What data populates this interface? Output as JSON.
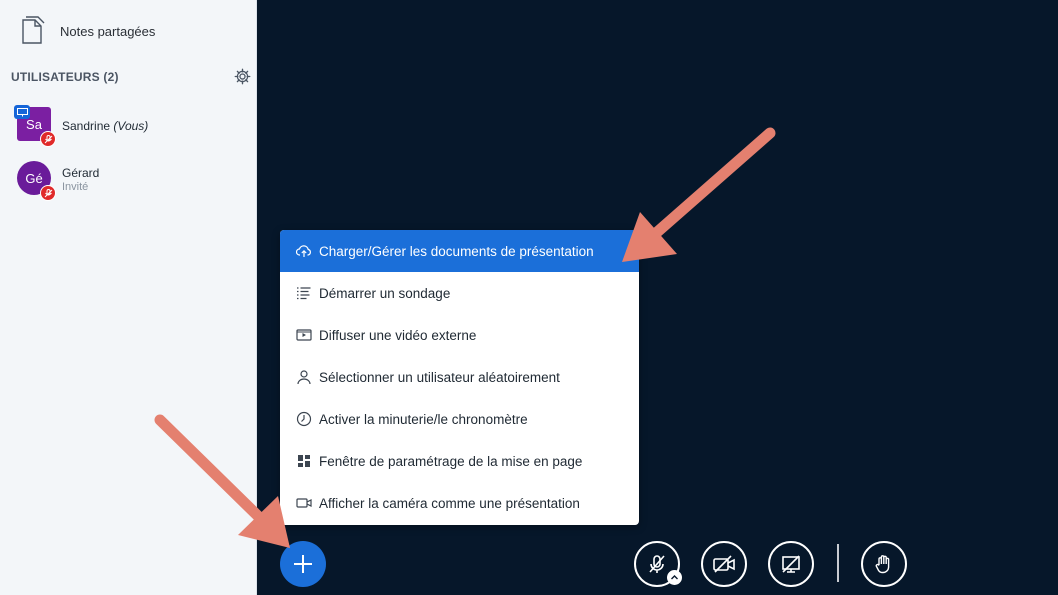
{
  "sidebar": {
    "notes_label": "Notes partagées",
    "users_header": "UTILISATEURS (2)",
    "users": [
      {
        "initials": "Sa",
        "name": "Sandrine",
        "name_suffix": "(Vous)",
        "subtitle": "",
        "presenter": true
      },
      {
        "initials": "Gé",
        "name": "Gérard",
        "name_suffix": "",
        "subtitle": "Invité",
        "presenter": false
      }
    ]
  },
  "menu": {
    "items": [
      {
        "label": "Charger/Gérer les documents de présentation",
        "icon": "upload-cloud-icon",
        "active": true
      },
      {
        "label": "Démarrer un sondage",
        "icon": "poll-list-icon",
        "active": false
      },
      {
        "label": "Diffuser une vidéo externe",
        "icon": "external-video-icon",
        "active": false
      },
      {
        "label": "Sélectionner un utilisateur aléatoirement",
        "icon": "user-icon",
        "active": false
      },
      {
        "label": "Activer la minuterie/le chronomètre",
        "icon": "timer-icon",
        "active": false
      },
      {
        "label": "Fenêtre de paramétrage de la mise en page",
        "icon": "layout-grid-icon",
        "active": false
      },
      {
        "label": "Afficher la caméra comme une présentation",
        "icon": "camera-icon",
        "active": false
      }
    ]
  },
  "toolbar": {
    "buttons": [
      "actions-plus-icon",
      "mic-muted-icon",
      "camera-off-icon",
      "screenshare-off-icon",
      "raise-hand-icon"
    ]
  },
  "colors": {
    "accent": "#1b6fd9",
    "background": "#06172a",
    "sidebar": "#f3f6f9",
    "avatar": "#7b1fa2",
    "muted_badge": "#e02a2a",
    "annotation_arrow": "#e4806f"
  }
}
